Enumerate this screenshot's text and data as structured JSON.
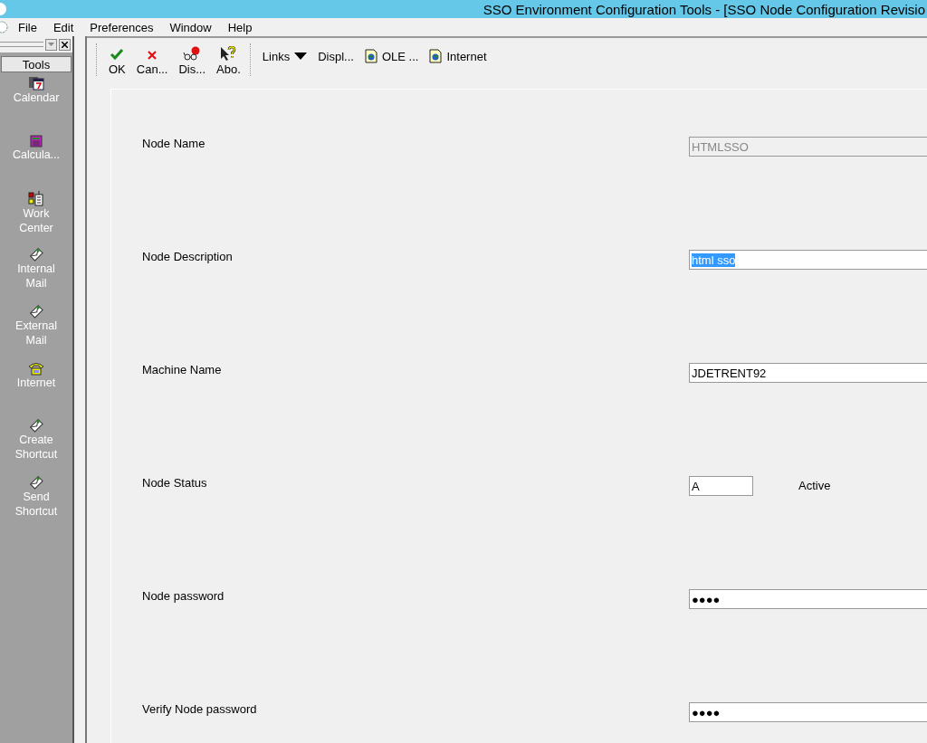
{
  "window": {
    "title": "SSO Environment Configuration Tools - [SSO Node Configuration Revisio"
  },
  "menu": [
    "File",
    "Edit",
    "Preferences",
    "Window",
    "Help"
  ],
  "sidebar": {
    "title": "Tools",
    "items": [
      {
        "kind": "calendar",
        "label": "Calendar"
      },
      {
        "kind": "calculator",
        "label": "Calcula..."
      },
      {
        "kind": "workcenter",
        "label": "Work Center"
      },
      {
        "kind": "mail",
        "label": "Internal Mail"
      },
      {
        "kind": "mail",
        "label": "External Mail"
      },
      {
        "kind": "phone",
        "label": "Internet"
      },
      {
        "kind": "mail",
        "label": "Create Shortcut"
      },
      {
        "kind": "mail",
        "label": "Send Shortcut"
      }
    ]
  },
  "toolbar": [
    {
      "kind": "ok",
      "label": "OK"
    },
    {
      "kind": "cancel",
      "label": "Can..."
    },
    {
      "kind": "display",
      "label": "Dis..."
    },
    {
      "kind": "about",
      "label": "Abo."
    }
  ],
  "links": [
    {
      "kind": "dropdown",
      "label": "Links"
    },
    {
      "kind": "plain",
      "label": "Displ..."
    },
    {
      "kind": "doc",
      "label": "OLE ..."
    },
    {
      "kind": "doc",
      "label": "Internet"
    }
  ],
  "form": [
    {
      "label": "Node Name",
      "value": "HTMLSSO",
      "disabled": true,
      "highlighted": false,
      "kind": "wide"
    },
    {
      "label": "Node Description",
      "value": "html sso",
      "disabled": false,
      "highlighted": true,
      "kind": "wide"
    },
    {
      "label": "Machine Name",
      "value": "JDETRENT92",
      "disabled": false,
      "highlighted": false,
      "kind": "wide"
    },
    {
      "label": "Node Status",
      "value": "A",
      "disabled": false,
      "highlighted": false,
      "kind": "short",
      "description": "Active"
    },
    {
      "label": "Node password",
      "value": "●●●●",
      "disabled": false,
      "highlighted": false,
      "kind": "wide"
    },
    {
      "label": "Verify Node password",
      "value": "●●●●",
      "disabled": false,
      "highlighted": false,
      "kind": "wide"
    }
  ]
}
